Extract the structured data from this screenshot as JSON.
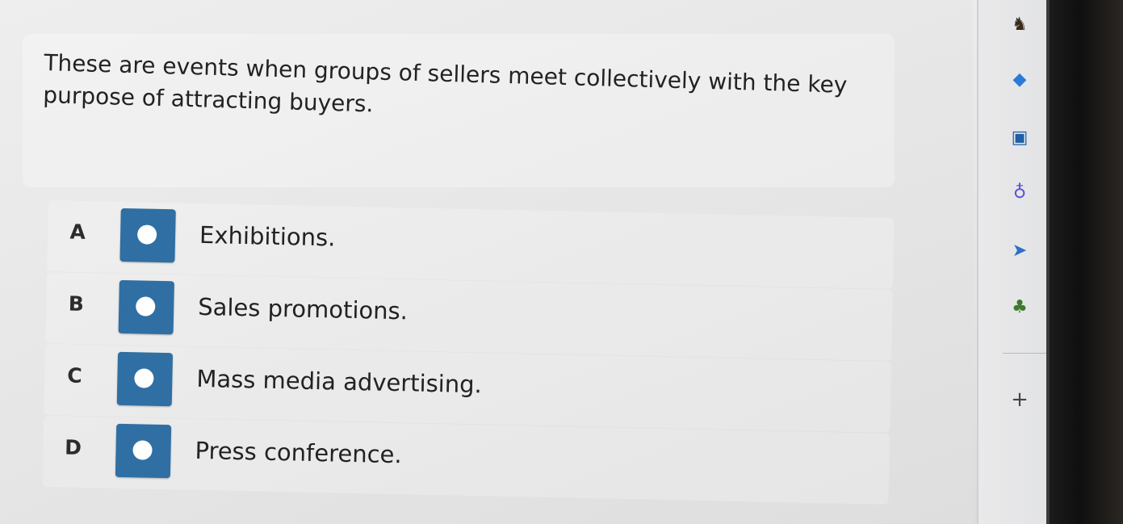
{
  "question": {
    "text": "These are events when groups of sellers meet collectively with the key purpose of attracting buyers."
  },
  "options": [
    {
      "letter": "A",
      "label": "Exhibitions."
    },
    {
      "letter": "B",
      "label": "Sales promotions."
    },
    {
      "letter": "C",
      "label": "Mass media advertising."
    },
    {
      "letter": "D",
      "label": "Press conference."
    }
  ],
  "sidebar": {
    "icons": [
      {
        "name": "chess-icon",
        "glyph": "♞"
      },
      {
        "name": "copilot-icon",
        "glyph": "◆"
      },
      {
        "name": "outlook-icon",
        "glyph": "▣"
      },
      {
        "name": "tools-icon",
        "glyph": "♁"
      },
      {
        "name": "send-icon",
        "glyph": "➤"
      },
      {
        "name": "tree-icon",
        "glyph": "♣"
      }
    ],
    "add_label": "+"
  },
  "colors": {
    "radio_bg": "#2f6fa3",
    "text": "#222222",
    "page_bg": "#e6e6e6"
  }
}
